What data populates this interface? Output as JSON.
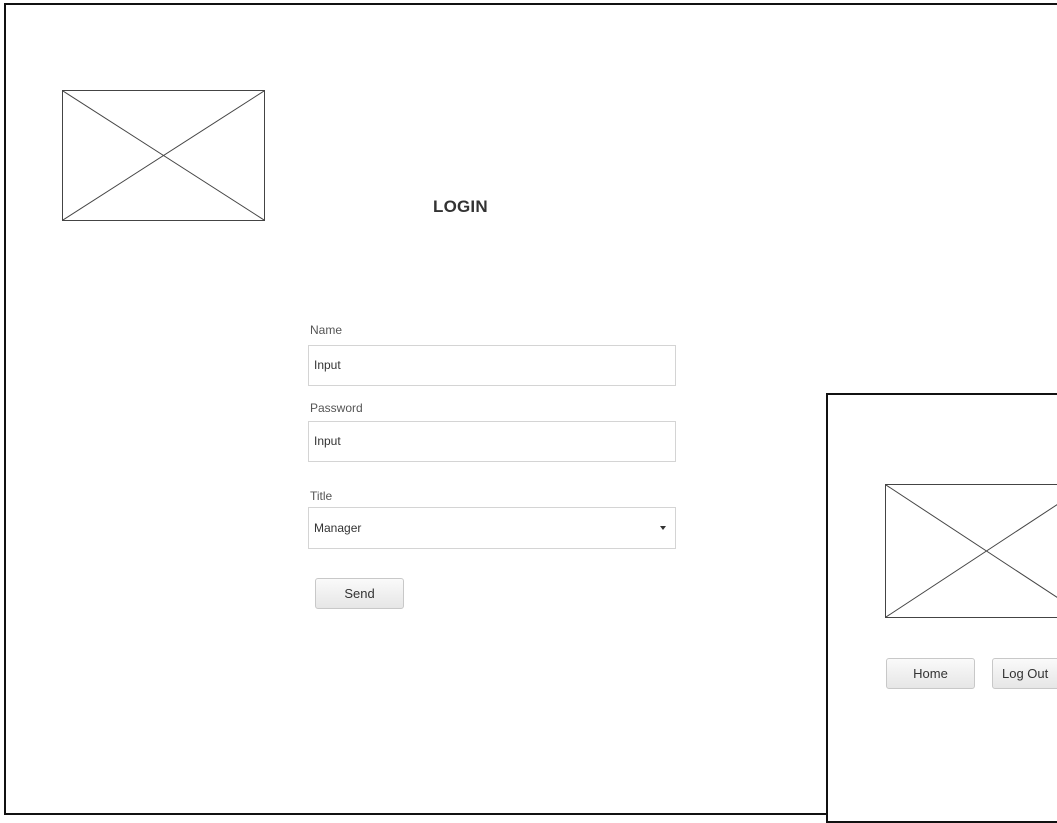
{
  "login_page": {
    "title": "LOGIN",
    "fields": {
      "name": {
        "label": "Name",
        "placeholder": "Input"
      },
      "password": {
        "label": "Password",
        "placeholder": "Input"
      },
      "title": {
        "label": "Title",
        "selected": "Manager"
      }
    },
    "send_button": "Send"
  },
  "secondary_page": {
    "home_button": "Home",
    "logout_button": "Log Out"
  }
}
